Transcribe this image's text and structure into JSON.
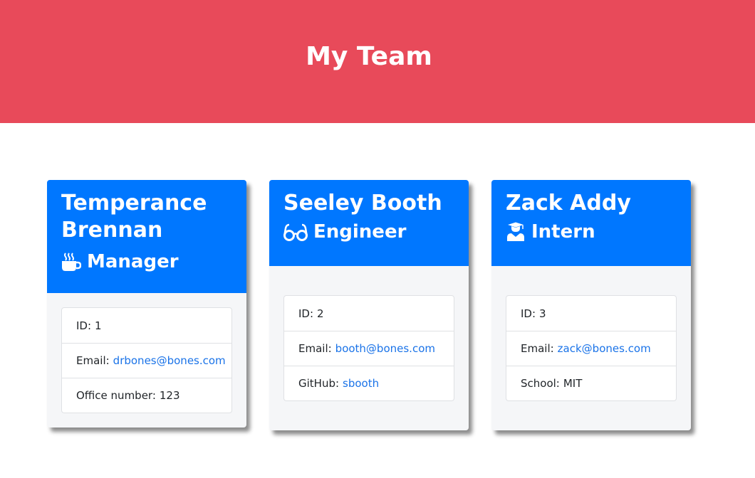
{
  "header": {
    "title": "My Team"
  },
  "team": [
    {
      "name": "Temperance Brennan",
      "role": "Manager",
      "icon": "coffee-icon",
      "id_label": "ID:",
      "id": "1",
      "email_label": "Email:",
      "email": "drbones@bones.com",
      "extra_label": "Office number:",
      "extra": "123"
    },
    {
      "name": "Seeley Booth",
      "role": "Engineer",
      "icon": "glasses-icon",
      "id_label": "ID:",
      "id": "2",
      "email_label": "Email:",
      "email": "booth@bones.com",
      "extra_label": "GitHub:",
      "extra": "sbooth"
    },
    {
      "name": "Zack Addy",
      "role": "Intern",
      "icon": "graduate-icon",
      "id_label": "ID:",
      "id": "3",
      "email_label": "Email:",
      "email": "zack@bones.com",
      "extra_label": "School:",
      "extra": "MIT"
    }
  ],
  "colors": {
    "jumbotron": "#e84a5a",
    "card_header": "#0077ff",
    "link": "#1a73e8"
  }
}
